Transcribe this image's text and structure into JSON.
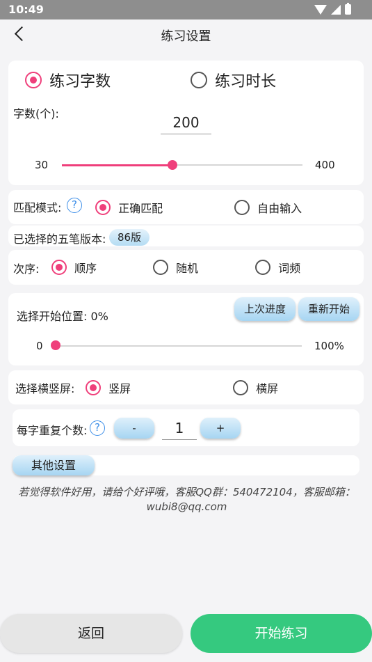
{
  "status_bar": {
    "time": "10:49"
  },
  "header": {
    "title": "练习设置"
  },
  "mode": {
    "options": [
      {
        "label": "练习字数",
        "selected": true
      },
      {
        "label": "练习时长",
        "selected": false
      }
    ]
  },
  "count": {
    "label": "字数(个):",
    "value": "200",
    "slider": {
      "min_label": "30",
      "max_label": "400",
      "min": 30,
      "max": 400,
      "value": 200
    }
  },
  "match": {
    "label": "匹配模式:",
    "help_icon": "?",
    "options": [
      {
        "label": "正确匹配",
        "selected": true
      },
      {
        "label": "自由输入",
        "selected": false
      }
    ]
  },
  "version": {
    "label": "已选择的五笔版本:",
    "badge": "86版"
  },
  "order": {
    "label": "次序:",
    "options": [
      {
        "label": "顺序",
        "selected": true
      },
      {
        "label": "随机",
        "selected": false
      },
      {
        "label": "词频",
        "selected": false
      }
    ]
  },
  "start_position": {
    "label": "选择开始位置: 0%",
    "last_progress_button": "上次进度",
    "restart_button": "重新开始",
    "slider": {
      "min_label": "0",
      "max_label": "100%",
      "value_fraction": 0
    }
  },
  "orientation": {
    "label": "选择横竖屏:",
    "options": [
      {
        "label": "竖屏",
        "selected": true
      },
      {
        "label": "横屏",
        "selected": false
      }
    ]
  },
  "repeat": {
    "label": "每字重复个数:",
    "help_icon": "?",
    "minus": "-",
    "value": "1",
    "plus": "+"
  },
  "other_settings": {
    "button": "其他设置"
  },
  "notice": "若觉得软件好用，请给个好评哦，客服QQ群：540472104，客服邮箱：wubi8@qq.com",
  "footer": {
    "back_button": "返回",
    "start_button": "开始练习"
  },
  "colors": {
    "accent": "#ef3f7b",
    "start_button": "#35c97f",
    "back_button": "#e6e6e6",
    "help": "#3c8ee8"
  }
}
